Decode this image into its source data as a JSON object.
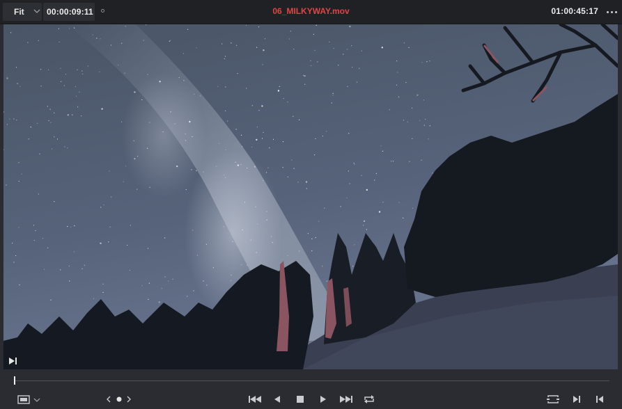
{
  "viewer": {
    "zoom_label": "Fit",
    "source_timecode": "00:00:09:11",
    "clip_name": "06_MILKYWAY.mov",
    "record_timecode": "01:00:45:17",
    "playhead_fraction": 0.0
  },
  "colors": {
    "clip_name": "#e04545",
    "panel_bg": "#2a2c31",
    "topbar_bg": "#1f2125",
    "icon": "#c9cbcf"
  },
  "icons": {
    "zoom_dropdown": "chevron-down-icon",
    "marker": "circle-icon",
    "options": "ellipsis-icon",
    "mark_in": "mark-in-icon",
    "viewer_mode": "film-frame-icon",
    "prev_edit": "chevron-left-icon",
    "edit_dot": "dot-icon",
    "next_edit": "chevron-right-icon",
    "jump_start": "skip-back-icon",
    "reverse": "play-reverse-icon",
    "stop": "stop-icon",
    "play": "play-icon",
    "jump_end": "skip-forward-icon",
    "loop": "loop-icon",
    "match_frame": "match-frame-icon",
    "next_frame": "step-forward-icon",
    "prev_frame": "step-back-icon"
  }
}
